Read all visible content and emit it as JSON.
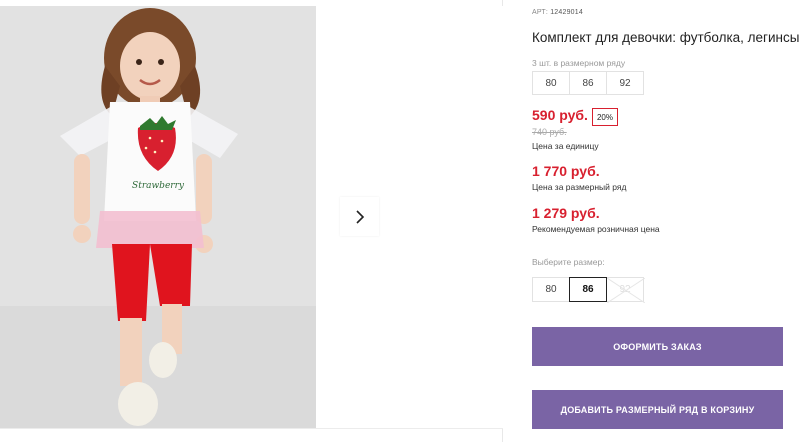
{
  "product": {
    "sku_prefix": "АРТ:",
    "sku": "12429014",
    "title": "Комплект для девочки: футболка, легинсы"
  },
  "gallery": {
    "photo_name": "girl-in-strawberry-outfit-photo",
    "next_icon": "chevron-right-icon",
    "shirt_print": "Strawberry"
  },
  "size_row": {
    "label": "3 шт. в размерном ряду",
    "sizes": [
      "80",
      "86",
      "92"
    ]
  },
  "prices": {
    "unit_price": "590 руб.",
    "discount": "20%",
    "old_price": "740 руб.",
    "unit_label": "Цена за единицу",
    "row_price": "1 770 руб.",
    "row_label": "Цена за размерный ряд",
    "rrp_price": "1 279 руб.",
    "rrp_label": "Рекомендуемая розничная цена",
    "accent_color": "#d8202f"
  },
  "size_picker": {
    "label": "Выберите размер:",
    "options": [
      {
        "value": "80",
        "state": "available"
      },
      {
        "value": "86",
        "state": "selected"
      },
      {
        "value": "92",
        "state": "unavailable"
      }
    ]
  },
  "actions": {
    "order_label": "ОФОРМИТЬ ЗАКАЗ",
    "add_row_label": "ДОБАВИТЬ РАЗМЕРНЫЙ РЯД В КОРЗИНУ",
    "button_color": "#7a64a5"
  }
}
